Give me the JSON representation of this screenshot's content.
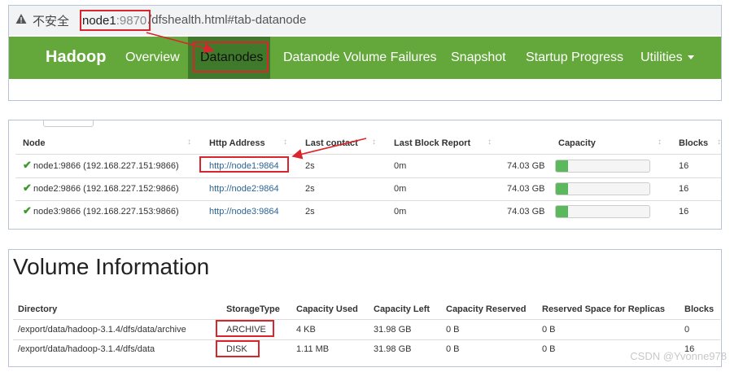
{
  "browser": {
    "insecure_label": "不安全",
    "separator": "|",
    "url_host": "node1",
    "url_port": ":9870",
    "url_path": "/dfshealth.html#tab-datanode"
  },
  "navbar": {
    "brand": "Hadoop",
    "items": [
      "Overview",
      "Datanodes",
      "Datanode Volume Failures",
      "Snapshot",
      "Startup Progress",
      "Utilities"
    ],
    "active": "Datanodes",
    "color": "#64a83c",
    "active_color": "#3f7a2a"
  },
  "datanodes": {
    "columns": [
      "Node",
      "Http Address",
      "Last contact",
      "Last Block Report",
      "Capacity",
      "Blocks"
    ],
    "sort_icon": "↕",
    "status_icon": "✔",
    "rows": [
      {
        "node": "node1:9866 (192.168.227.151:9866)",
        "http": "http://node1:9864",
        "last_contact": "2s",
        "last_block_report": "0m",
        "capacity": "74.03 GB",
        "used_fraction": 0.13,
        "blocks": "16"
      },
      {
        "node": "node2:9866 (192.168.227.152:9866)",
        "http": "http://node2:9864",
        "last_contact": "2s",
        "last_block_report": "0m",
        "capacity": "74.03 GB",
        "used_fraction": 0.13,
        "blocks": "16"
      },
      {
        "node": "node3:9866 (192.168.227.153:9866)",
        "http": "http://node3:9864",
        "last_contact": "2s",
        "last_block_report": "0m",
        "capacity": "74.03 GB",
        "used_fraction": 0.13,
        "blocks": "16"
      }
    ]
  },
  "volume": {
    "title": "Volume Information",
    "columns": [
      "Directory",
      "StorageType",
      "Capacity Used",
      "Capacity Left",
      "Capacity Reserved",
      "Reserved Space for Replicas",
      "Blocks"
    ],
    "rows": [
      {
        "directory": "/export/data/hadoop-3.1.4/dfs/data/archive",
        "storage_type": "ARCHIVE",
        "used": "4 KB",
        "left": "31.98 GB",
        "reserved": "0 B",
        "replicas": "0 B",
        "blocks": "0"
      },
      {
        "directory": "/export/data/hadoop-3.1.4/dfs/data",
        "storage_type": "DISK",
        "used": "1.11 MB",
        "left": "31.98 GB",
        "reserved": "0 B",
        "replicas": "0 B",
        "blocks": "16"
      }
    ]
  },
  "watermark": "CSDN @Yvonne978",
  "annotation_color": "#d9262c"
}
